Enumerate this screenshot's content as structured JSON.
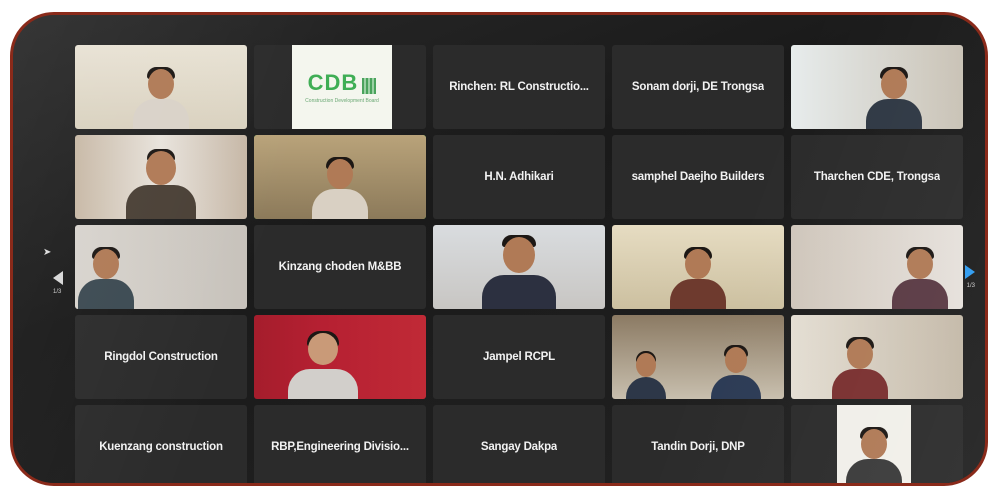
{
  "participants": [
    {
      "name": "",
      "type": "video"
    },
    {
      "name": "",
      "type": "logo",
      "logo_text": "CDB",
      "logo_sub": "Construction Development Board"
    },
    {
      "name": "Rinchen: RL Constructio...",
      "type": "name"
    },
    {
      "name": "Sonam dorji, DE Trongsa",
      "type": "name"
    },
    {
      "name": "",
      "type": "video"
    },
    {
      "name": "",
      "type": "video"
    },
    {
      "name": "",
      "type": "video",
      "active": true
    },
    {
      "name": "H.N. Adhikari",
      "type": "name"
    },
    {
      "name": "samphel Daejho Builders",
      "type": "name"
    },
    {
      "name": "Tharchen CDE, Trongsa",
      "type": "name"
    },
    {
      "name": "",
      "type": "video"
    },
    {
      "name": "Kinzang choden M&BB",
      "type": "name"
    },
    {
      "name": "",
      "type": "video"
    },
    {
      "name": "",
      "type": "video"
    },
    {
      "name": "",
      "type": "video"
    },
    {
      "name": "Ringdol Construction",
      "type": "name"
    },
    {
      "name": "",
      "type": "video"
    },
    {
      "name": "Jampel RCPL",
      "type": "name"
    },
    {
      "name": "",
      "type": "video"
    },
    {
      "name": "",
      "type": "video"
    },
    {
      "name": "Kuenzang construction",
      "type": "name"
    },
    {
      "name": "RBP,Engineering Divisio...",
      "type": "name"
    },
    {
      "name": "Sangay Dakpa",
      "type": "name"
    },
    {
      "name": "Tandin Dorji, DNP",
      "type": "name"
    },
    {
      "name": "",
      "type": "video"
    }
  ],
  "pagination": {
    "left": "1/3",
    "right": "1/3"
  },
  "colors": {
    "active_border": "#32d74b",
    "tile_bg": "#2b2b2b",
    "next_arrow": "#2e9bf0"
  }
}
